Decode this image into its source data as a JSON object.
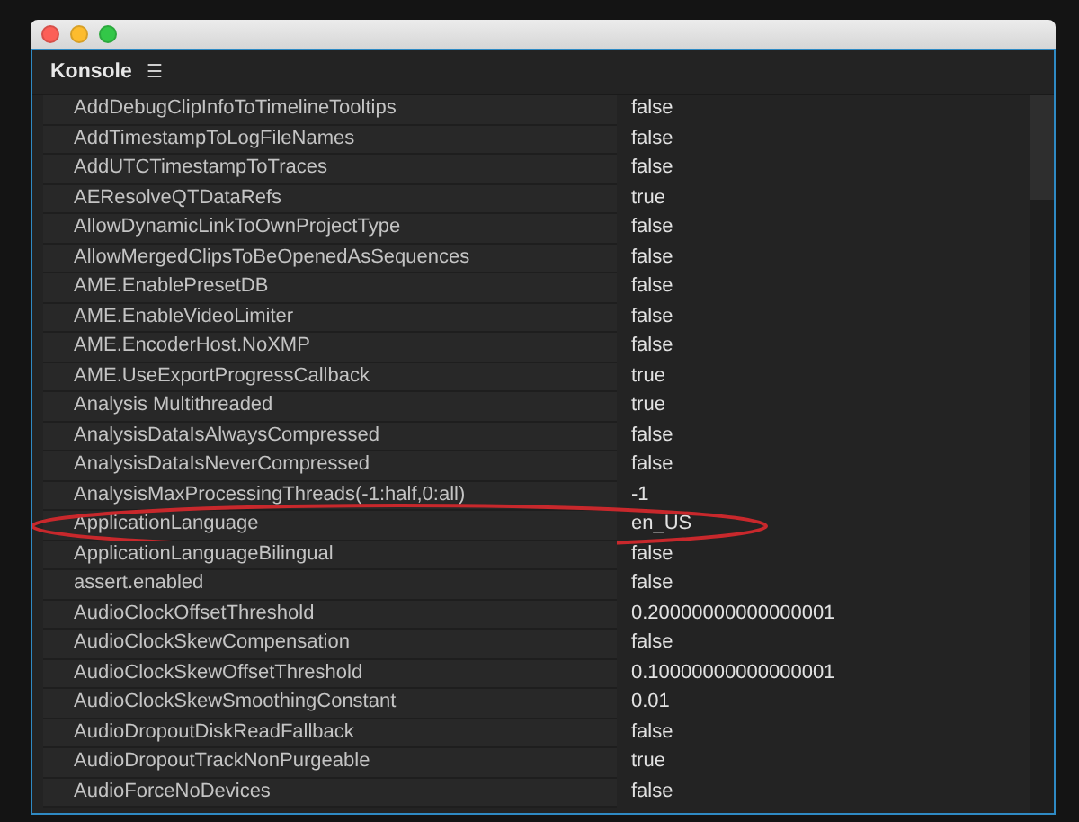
{
  "panel": {
    "title": "Konsole",
    "menu_glyph": "☰"
  },
  "rows": [
    {
      "name": "AddDebugClipInfoToTimelineTooltips",
      "value": "false",
      "circled": false
    },
    {
      "name": "AddTimestampToLogFileNames",
      "value": "false",
      "circled": false
    },
    {
      "name": "AddUTCTimestampToTraces",
      "value": "false",
      "circled": false
    },
    {
      "name": "AEResolveQTDataRefs",
      "value": "true",
      "circled": false
    },
    {
      "name": "AllowDynamicLinkToOwnProjectType",
      "value": "false",
      "circled": false
    },
    {
      "name": "AllowMergedClipsToBeOpenedAsSequences",
      "value": "false",
      "circled": false
    },
    {
      "name": "AME.EnablePresetDB",
      "value": "false",
      "circled": false
    },
    {
      "name": "AME.EnableVideoLimiter",
      "value": "false",
      "circled": false
    },
    {
      "name": "AME.EncoderHost.NoXMP",
      "value": "false",
      "circled": false
    },
    {
      "name": "AME.UseExportProgressCallback",
      "value": "true",
      "circled": false
    },
    {
      "name": "Analysis Multithreaded",
      "value": "true",
      "circled": false
    },
    {
      "name": "AnalysisDataIsAlwaysCompressed",
      "value": "false",
      "circled": false
    },
    {
      "name": "AnalysisDataIsNeverCompressed",
      "value": "false",
      "circled": false
    },
    {
      "name": "AnalysisMaxProcessingThreads(-1:half,0:all)",
      "value": "-1",
      "circled": false
    },
    {
      "name": "ApplicationLanguage",
      "value": "en_US",
      "circled": true
    },
    {
      "name": "ApplicationLanguageBilingual",
      "value": "false",
      "circled": false
    },
    {
      "name": "assert.enabled",
      "value": "false",
      "circled": false
    },
    {
      "name": "AudioClockOffsetThreshold",
      "value": "0.20000000000000001",
      "circled": false
    },
    {
      "name": "AudioClockSkewCompensation",
      "value": "false",
      "circled": false
    },
    {
      "name": "AudioClockSkewOffsetThreshold",
      "value": "0.10000000000000001",
      "circled": false
    },
    {
      "name": "AudioClockSkewSmoothingConstant",
      "value": "0.01",
      "circled": false
    },
    {
      "name": "AudioDropoutDiskReadFallback",
      "value": "false",
      "circled": false
    },
    {
      "name": "AudioDropoutTrackNonPurgeable",
      "value": "true",
      "circled": false
    },
    {
      "name": "AudioForceNoDevices",
      "value": "false",
      "circled": false
    }
  ]
}
